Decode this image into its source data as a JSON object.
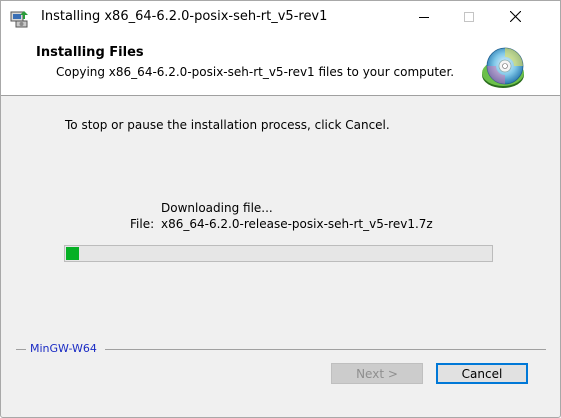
{
  "window": {
    "title": "Installing x86_64-6.2.0-posix-seh-rt_v5-rev1"
  },
  "header": {
    "title": "Installing Files",
    "subtitle": "Copying x86_64-6.2.0-posix-seh-rt_v5-rev1 files to your computer."
  },
  "body": {
    "instruction": "To stop or pause the installation process, click Cancel.",
    "status": "Downloading file...",
    "file_label": "File:",
    "file_name": "x86_64-6.2.0-release-posix-seh-rt_v5-rev1.7z",
    "progress_fraction": 0.03
  },
  "footer": {
    "brand": "MinGW-W64",
    "next_label": "Next >",
    "cancel_label": "Cancel"
  },
  "icons": {
    "app": "installer-icon",
    "header": "cd-disc-icon",
    "minimize": "minimize-icon",
    "maximize": "maximize-icon",
    "close": "close-icon"
  },
  "colors": {
    "progress_fill": "#06b025",
    "brand_text": "#1a2bc4",
    "default_button_border": "#0078d7"
  }
}
